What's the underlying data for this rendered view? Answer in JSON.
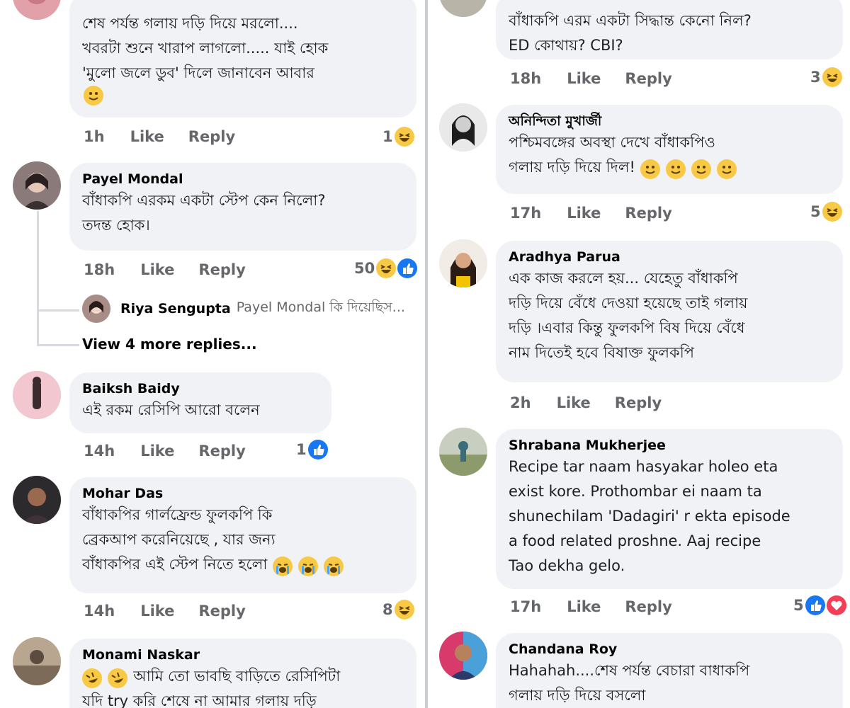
{
  "left": {
    "c0": {
      "text": "শেষ পর্যন্ত গলায় দড়ি দিয়ে মরলো....\nখবরটা শুনে খারাপ লাগলো..... যাই হোক\n'মুলো জলে ডুব' দিলে জানাবেন আবার",
      "time": "1h",
      "like": "Like",
      "reply": "Reply",
      "count": "1"
    },
    "c1": {
      "name": "Payel Mondal",
      "text": "বাঁধাকপি এরকম একটা স্টেপ কেন নিলো?\nতদন্ত হোক।",
      "time": "18h",
      "like": "Like",
      "reply": "Reply",
      "count": "50",
      "reply_preview": {
        "name": "Riya Sengupta",
        "text": "Payel Mondal কি দিয়েছিস..."
      },
      "more": "View 4 more replies..."
    },
    "c2": {
      "name": "Baiksh Baidy",
      "text": "এই রকম রেসিপি আরো বলেন",
      "time": "14h",
      "like": "Like",
      "reply": "Reply",
      "count": "1"
    },
    "c3": {
      "name": "Mohar Das",
      "text": "বাঁধাকপির গার্লফ্রেন্ড ফুলকপি কি\nব্রেকআপ করেনিয়েছে , যার জন্য\nবাঁধাকপির এই স্টেপ নিতে হলো",
      "time": "14h",
      "like": "Like",
      "reply": "Reply",
      "count": "8"
    },
    "c4": {
      "name": "Monami Naskar",
      "text": "আমি তো ভাবছি বাড়িতে রেসিপিটা\nযদি try করি শেষে না আমার গলায় দড়ি"
    }
  },
  "right": {
    "c0": {
      "text": "বাঁধাকপি এরম একটা সিদ্ধান্ত কেনো নিল?\nED কোথায়? CBI?",
      "time": "18h",
      "like": "Like",
      "reply": "Reply",
      "count": "3"
    },
    "c1": {
      "name": "অনিন্দিতা মুখার্জী",
      "text": "পশ্চিমবঙ্গের অবস্থা দেখে বাঁধাকপিও\nগলায় দড়ি দিয়ে দিল!",
      "time": "17h",
      "like": "Like",
      "reply": "Reply",
      "count": "5"
    },
    "c2": {
      "name": "Aradhya Parua",
      "text": "এক কাজ করলে হয়... যেহেতু বাঁধাকপি\nদড়ি দিয়ে বেঁধে দেওয়া হয়েছে তাই গলায়\nদড়ি ।এবার কিন্তু ফুলকপি বিষ দিয়ে বেঁধে\nনাম দিতেই হবে বিষাক্ত ফুলকপি",
      "time": "2h",
      "like": "Like",
      "reply": "Reply"
    },
    "c3": {
      "name": "Shrabana Mukherjee",
      "text": "Recipe tar naam hasyakar holeo eta\nexist kore. Prothombar ei naam ta\nshunechilam 'Dadagiri' r ekta episode\na food related proshne. Aaj recipe\nTao dekha gelo.",
      "time": "17h",
      "like": "Like",
      "reply": "Reply",
      "count": "5"
    },
    "c4": {
      "name": "Chandana Roy",
      "text": "Hahahah....শেষ পর্যন্ত বেচারা বাধাকপি\nগলায় দড়ি দিয়ে বসলো"
    }
  },
  "colors": {
    "bubble": "#f0f2f5",
    "meta": "#65676b",
    "like_blue": "#1877f2",
    "love_red": "#f33e58",
    "haha_yellow": "#f7c944"
  },
  "icons": [
    "haha-reaction-icon",
    "like-reaction-icon",
    "love-reaction-icon",
    "smile-emoji-icon",
    "crying-emoji-icon",
    "rofl-emoji-icon"
  ]
}
